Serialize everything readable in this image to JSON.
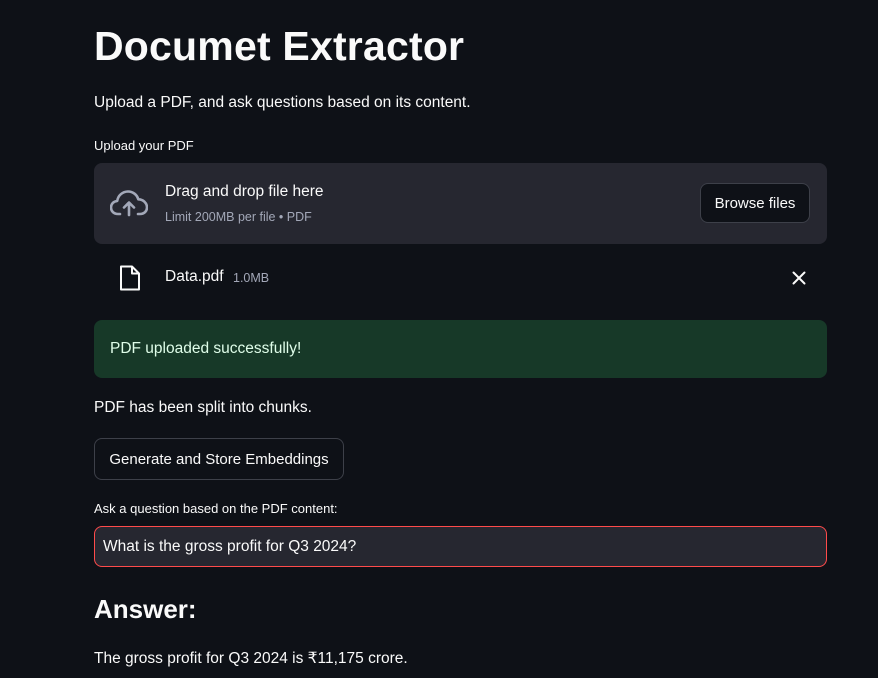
{
  "header": {
    "title": "Documet Extractor",
    "subtitle": "Upload a PDF, and ask questions based on its content."
  },
  "uploader": {
    "label": "Upload your PDF",
    "drop_title": "Drag and drop file here",
    "drop_limit": "Limit 200MB per file • PDF",
    "browse_label": "Browse files",
    "icon": "cloud-upload-icon"
  },
  "uploaded_file": {
    "name": "Data.pdf",
    "size": "1.0MB",
    "icon": "file-icon"
  },
  "status": {
    "success": "PDF uploaded successfully!",
    "split": "PDF has been split into chunks."
  },
  "embeddings": {
    "button_label": "Generate and Store Embeddings"
  },
  "question": {
    "label": "Ask a question based on the PDF content:",
    "value": "What is the gross profit for Q3 2024?"
  },
  "answer": {
    "heading": "Answer:",
    "text": "The gross profit for Q3 2024 is ₹11,175 crore."
  },
  "colors": {
    "background": "#0e1117",
    "panel": "#262730",
    "success_bg": "#173928",
    "input_focus_border": "#ff4b4b"
  }
}
